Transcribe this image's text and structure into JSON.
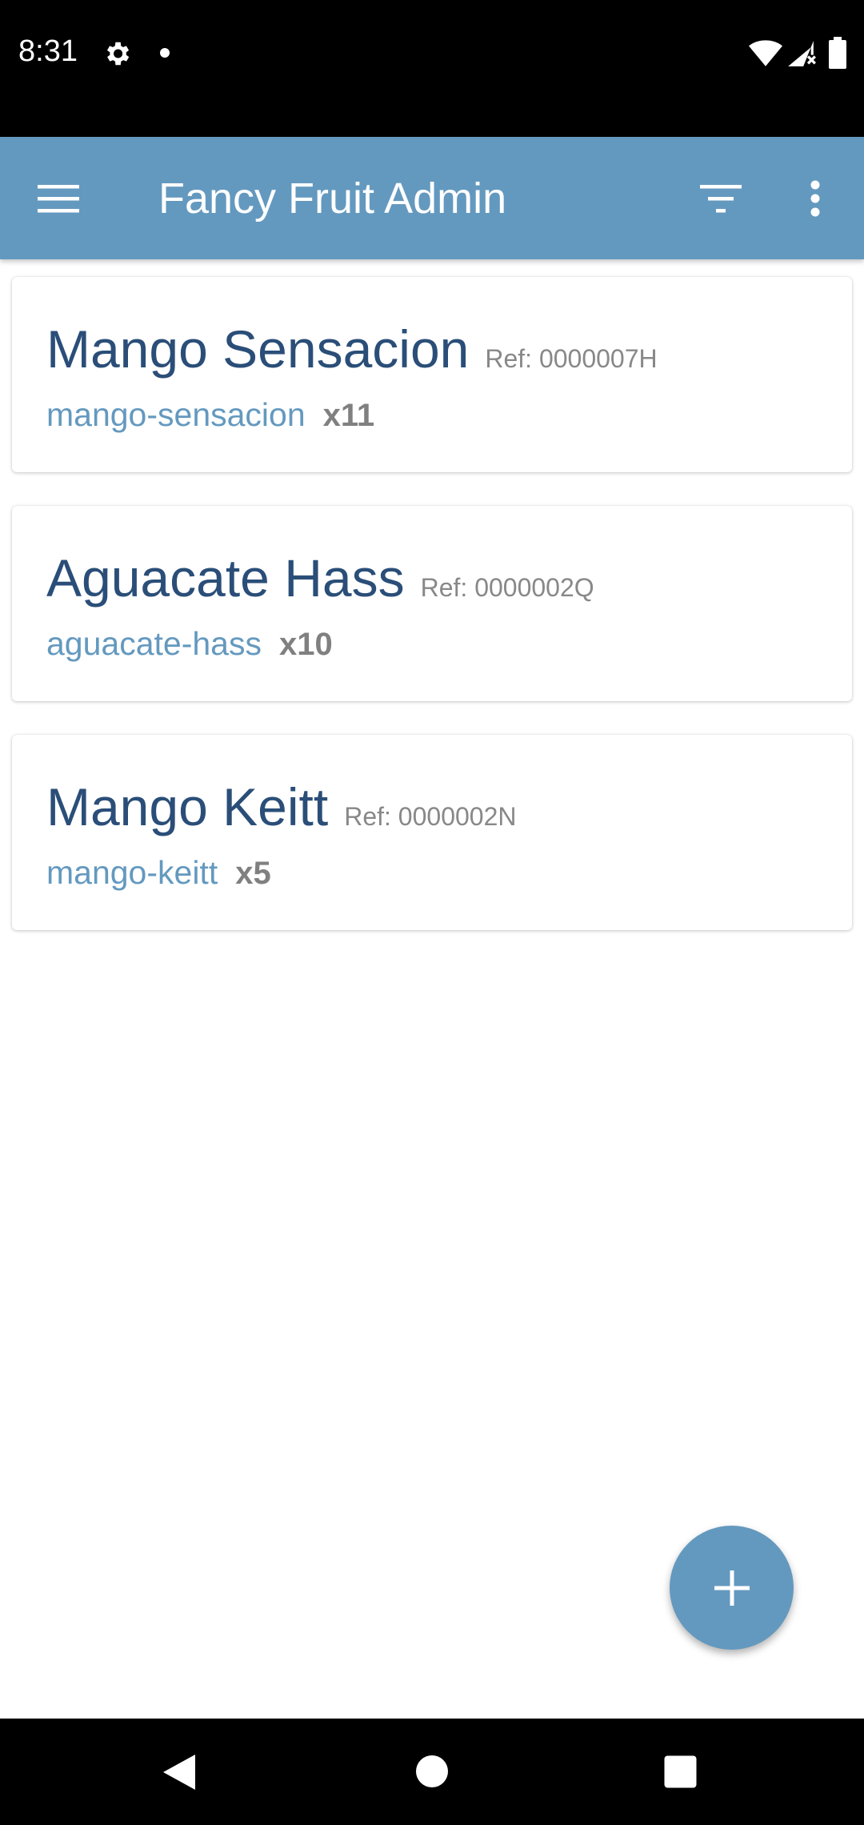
{
  "status_bar": {
    "time": "8:31",
    "icons": [
      "gear-icon",
      "notification-dot-icon",
      "wifi-icon",
      "signal-icon",
      "battery-icon"
    ]
  },
  "app_bar": {
    "title": "Fancy Fruit Admin",
    "background": "#6499bf",
    "icons": [
      "menu-icon",
      "filter-icon",
      "more-vert-icon"
    ]
  },
  "products": [
    {
      "name": "Mango Sensacion",
      "ref": "Ref: 0000007H",
      "slug": "mango-sensacion",
      "qty": "x11"
    },
    {
      "name": "Aguacate Hass",
      "ref": "Ref: 0000002Q",
      "slug": "aguacate-hass",
      "qty": "x10"
    },
    {
      "name": "Mango Keitt",
      "ref": "Ref: 0000002N",
      "slug": "mango-keitt",
      "qty": "x5"
    }
  ],
  "fab": {
    "icon": "plus-icon"
  },
  "nav_bar": {
    "icons": [
      "back-icon",
      "home-icon",
      "recents-icon"
    ]
  },
  "colors": {
    "accent": "#6499bf",
    "title_text": "#2a4e78",
    "muted_text": "#888888"
  }
}
